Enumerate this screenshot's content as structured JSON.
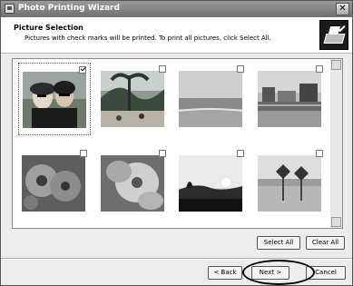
{
  "window": {
    "title": "Photo Printing Wizard",
    "close_label": "✕"
  },
  "header": {
    "title": "Picture Selection",
    "subtitle": "Pictures with check marks will be printed.  To print all pictures, click Select All."
  },
  "pictures": [
    {
      "name": "portrait-two-women",
      "checked": true,
      "selected": true
    },
    {
      "name": "tropical-beach-palms",
      "checked": false,
      "selected": false
    },
    {
      "name": "ocean-horizon",
      "checked": false,
      "selected": false
    },
    {
      "name": "pier-buildings",
      "checked": false,
      "selected": false
    },
    {
      "name": "red-flower",
      "checked": false,
      "selected": false
    },
    {
      "name": "pink-flower-closeup",
      "checked": false,
      "selected": false
    },
    {
      "name": "sunset-silhouette",
      "checked": false,
      "selected": false
    },
    {
      "name": "sign-on-beach",
      "checked": false,
      "selected": false
    }
  ],
  "buttons": {
    "select_all": "Select All",
    "clear_all": "Clear All",
    "back": "< Back",
    "next": "Next >",
    "cancel": "Cancel"
  }
}
